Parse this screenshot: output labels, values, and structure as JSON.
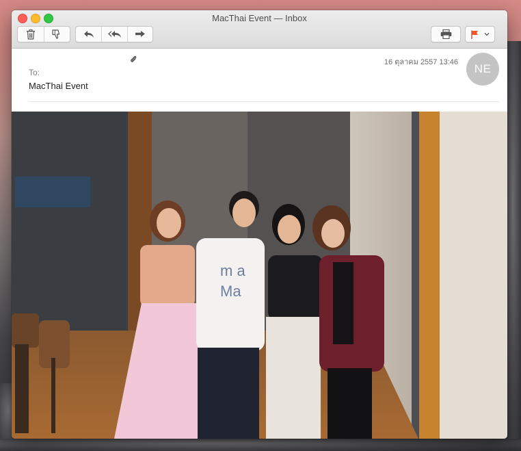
{
  "window": {
    "title": "MacThai Event — Inbox"
  },
  "toolbar": {
    "delete_icon": "trash-icon",
    "junk_icon": "thumbs-down-icon",
    "reply_icon": "reply-arrow-icon",
    "reply_all_icon": "reply-all-arrow-icon",
    "forward_icon": "forward-arrow-icon",
    "print_icon": "printer-icon",
    "flag_icon": "flag-icon",
    "flag_color": "#f0572a"
  },
  "message": {
    "date": "16 ตุลาคม 2557 13:46",
    "avatar_initials": "NE",
    "to_label": "To:",
    "to_value": "MacThai Event",
    "has_attachment": true
  },
  "content": {
    "photo_subject": "four people posing in a room with wooden floor"
  }
}
